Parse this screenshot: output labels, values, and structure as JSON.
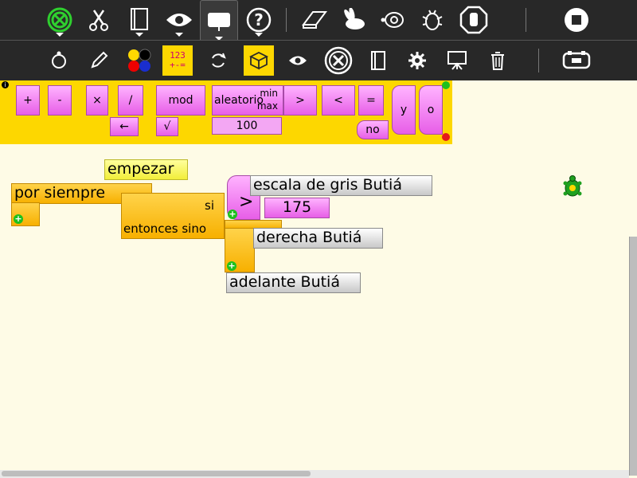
{
  "toolbar": {
    "icons": [
      "activity-icon",
      "cut-icon",
      "project-icon",
      "view-icon",
      "presentation-icon",
      "help-icon",
      "eraser-icon",
      "rabbit-icon",
      "turtle-icon",
      "bug-icon",
      "stop-hand-icon",
      "stop-icon"
    ]
  },
  "palette_toolbar": {
    "icons": [
      "turtle-palette-icon",
      "pen-palette-icon",
      "colors-palette-icon",
      "numbers-palette-icon",
      "flow-palette-icon",
      "blocks-palette-icon",
      "sensors-palette-icon",
      "extras-palette-icon",
      "portfolio-palette-icon",
      "settings-palette-icon",
      "presentation-palette-icon",
      "trash-palette-icon",
      "butia-palette-icon"
    ],
    "numbers_label_top": "123",
    "numbers_label_bottom": "+-="
  },
  "palette": {
    "plus": "+",
    "minus": "-",
    "times": "×",
    "divide": "/",
    "mod": "mod",
    "random": "aleatorio",
    "random_min": "min",
    "random_max": "max",
    "gt": ">",
    "lt": "<",
    "eq": "=",
    "and": "y",
    "or": "o",
    "not": "no",
    "identity": "←",
    "sqrt": "√",
    "number": "100"
  },
  "canvas": {
    "start": "empezar",
    "forever": "por siempre",
    "if_label": "si",
    "else_label": "entonces sino",
    "greater": ">",
    "grayscale": "escala de gris Butiá",
    "number": "175",
    "right": "derecha Butiá",
    "forward": "adelante Butiá"
  },
  "colors": {
    "toolbar": "#282828",
    "palette": "#fdd700",
    "canvas": "#fefbe6",
    "block_pink": "#e75ee7",
    "block_yellow": "#f7b000"
  }
}
